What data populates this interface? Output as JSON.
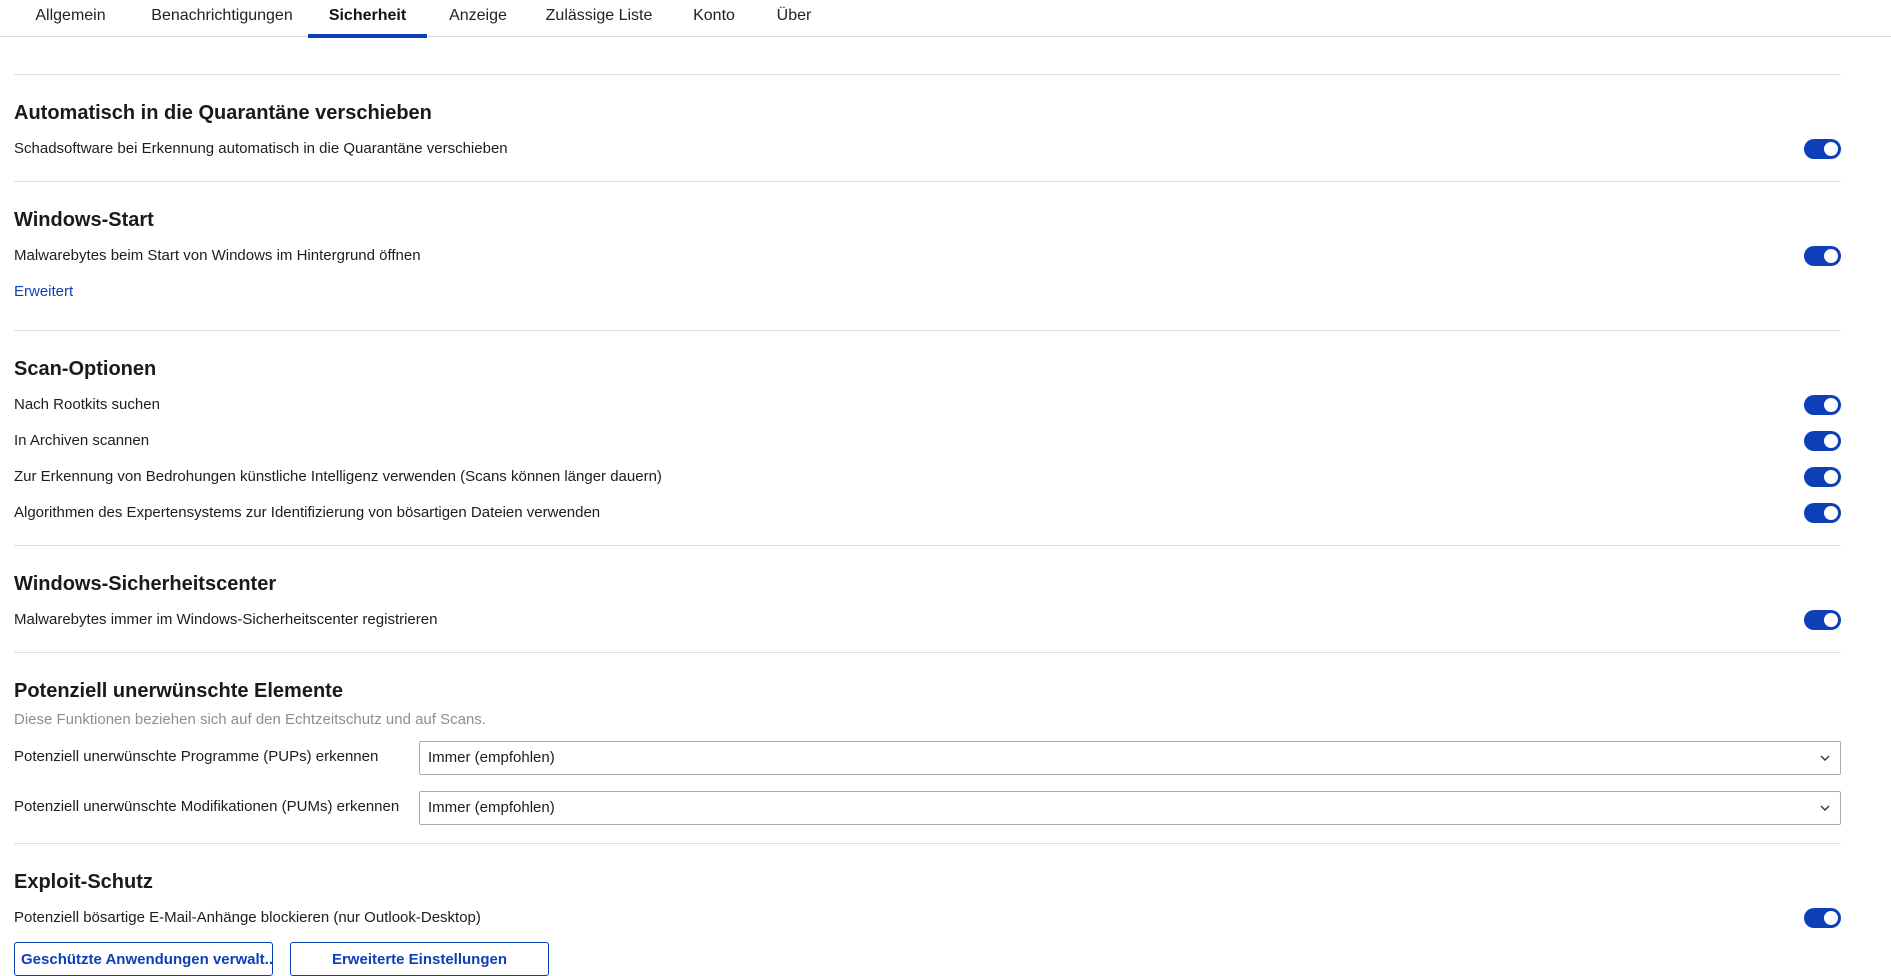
{
  "tabs": [
    {
      "label": "Allgemein",
      "active": false
    },
    {
      "label": "Benachrichtigungen",
      "active": false
    },
    {
      "label": "Sicherheit",
      "active": true
    },
    {
      "label": "Anzeige",
      "active": false
    },
    {
      "label": "Zulässige Liste",
      "active": false
    },
    {
      "label": "Konto",
      "active": false
    },
    {
      "label": "Über",
      "active": false
    }
  ],
  "quarantine": {
    "title": "Automatisch in die Quarantäne verschieben",
    "option": "Schadsoftware bei Erkennung automatisch in die Quarantäne verschieben",
    "enabled": true
  },
  "windows_start": {
    "title": "Windows-Start",
    "option": "Malwarebytes beim Start von Windows im Hintergrund öffnen",
    "enabled": true,
    "advanced_link": "Erweitert"
  },
  "scan_options": {
    "title": "Scan-Optionen",
    "options": [
      {
        "label": "Nach Rootkits suchen",
        "enabled": true
      },
      {
        "label": "In Archiven scannen",
        "enabled": true
      },
      {
        "label": "Zur Erkennung von Bedrohungen künstliche Intelligenz verwenden (Scans können länger dauern)",
        "enabled": true
      },
      {
        "label": "Algorithmen des Expertensystems zur Identifizierung von bösartigen Dateien verwenden",
        "enabled": true
      }
    ]
  },
  "security_center": {
    "title": "Windows-Sicherheitscenter",
    "option": "Malwarebytes immer im Windows-Sicherheitscenter registrieren",
    "enabled": true
  },
  "pup": {
    "title": "Potenziell unerwünschte Elemente",
    "subtitle": "Diese Funktionen beziehen sich auf den Echtzeitschutz und auf Scans.",
    "pups_label": "Potenziell unerwünschte Programme (PUPs) erkennen",
    "pups_value": "Immer (empfohlen)",
    "pums_label": "Potenziell unerwünschte Modifikationen (PUMs) erkennen",
    "pums_value": "Immer (empfohlen)"
  },
  "exploit": {
    "title": "Exploit-Schutz",
    "option": "Potenziell bösartige E-Mail-Anhänge blockieren (nur Outlook-Desktop)",
    "enabled": true,
    "manage_button": "Geschützte Anwendungen verwalt...",
    "advanced_button": "Erweiterte Einstellungen"
  },
  "colors": {
    "accent": "#0d3fb8",
    "divider": "#dedfe2",
    "subtitle": "#8a8f98"
  }
}
